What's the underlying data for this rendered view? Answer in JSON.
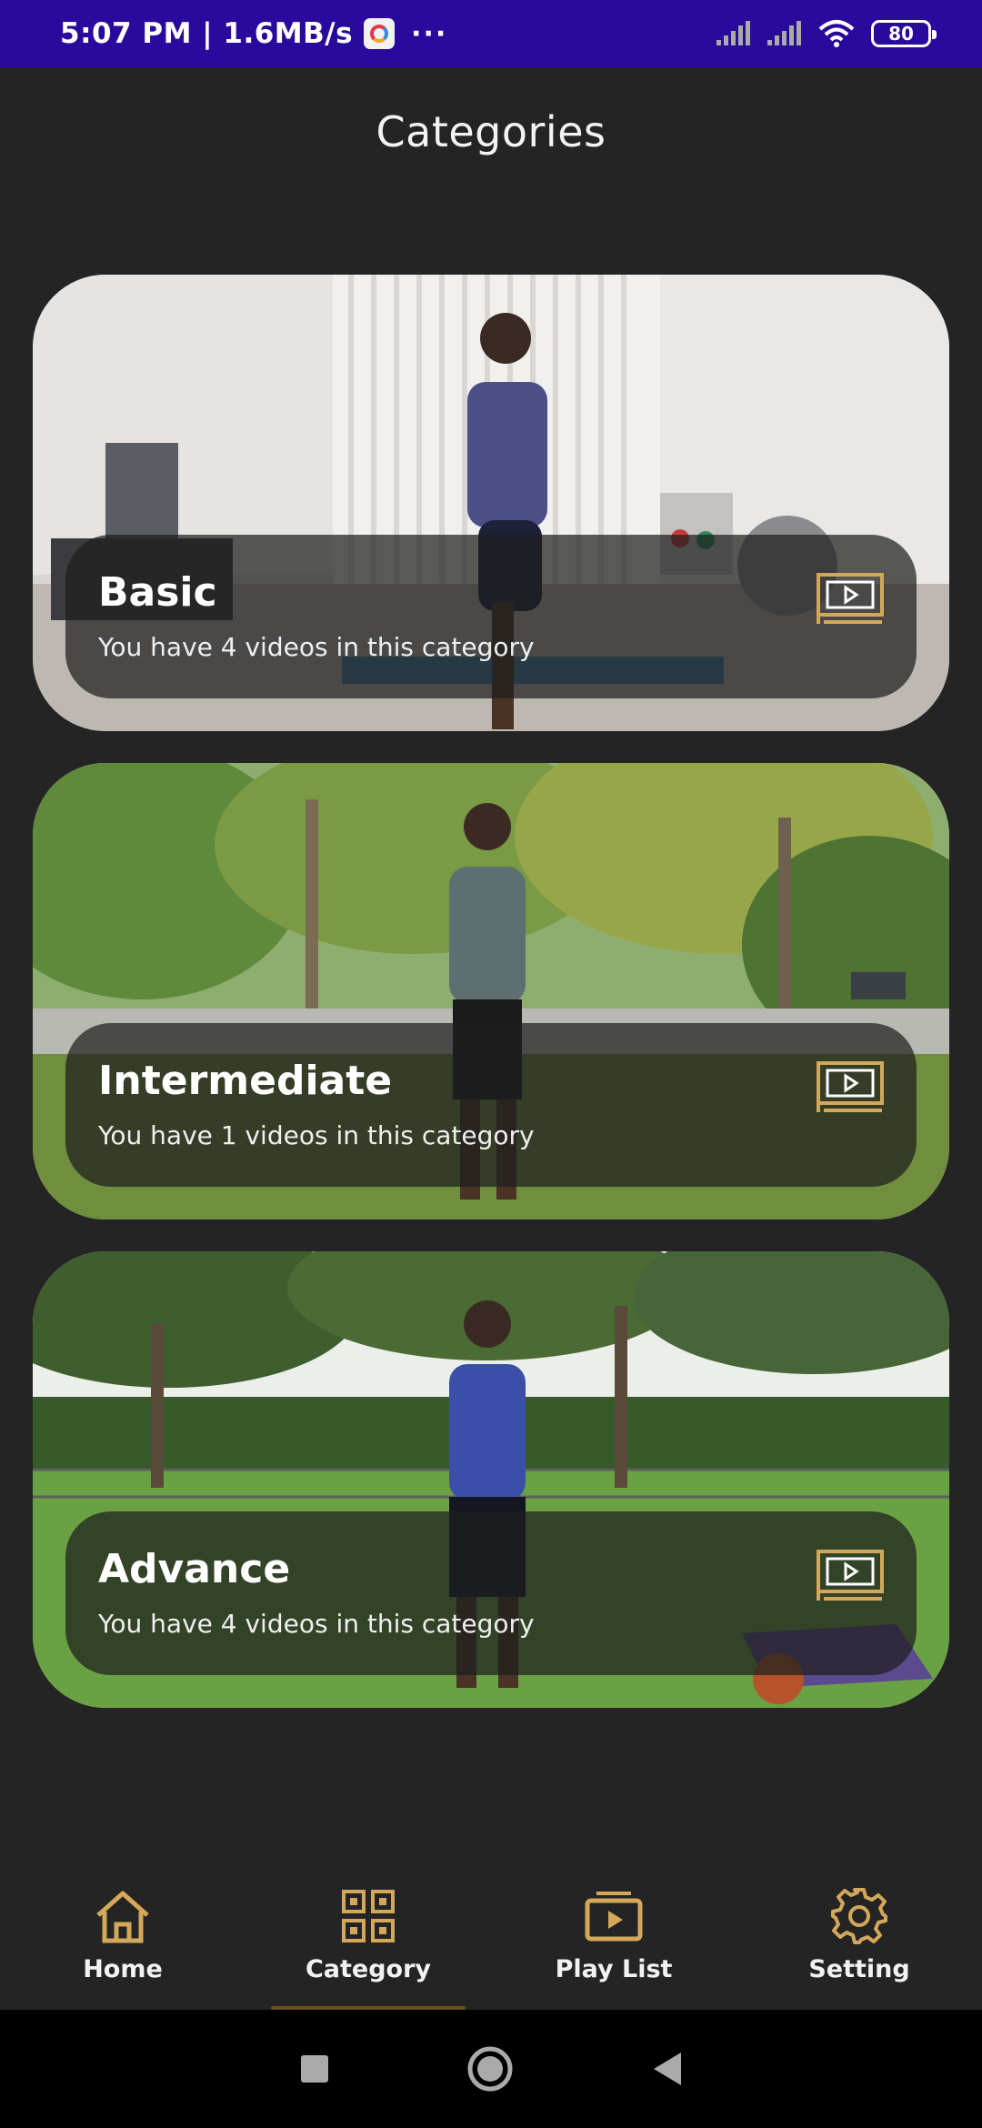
{
  "status_bar": {
    "time_speed": "5:07 PM | 1.6MB/s",
    "more": "···",
    "battery": "80"
  },
  "header": {
    "title": "Categories"
  },
  "categories": [
    {
      "title": "Basic",
      "subtitle": "You have 4 videos in this category",
      "icon": "video-library-icon"
    },
    {
      "title": "Intermediate",
      "subtitle": "You have 1 videos in this category",
      "icon": "video-library-icon"
    },
    {
      "title": "Advance",
      "subtitle": "You have 4 videos in this category",
      "icon": "video-library-icon"
    }
  ],
  "bottom_nav": {
    "items": [
      {
        "label": "Home",
        "icon": "home-icon"
      },
      {
        "label": "Category",
        "icon": "grid-icon"
      },
      {
        "label": "Play List",
        "icon": "playlist-icon"
      },
      {
        "label": "Setting",
        "icon": "gear-icon"
      }
    ],
    "active": "Category"
  },
  "colors": {
    "status_bar": "#2a0a9c",
    "background": "#242424",
    "accent_gold": "#d4a85a"
  }
}
